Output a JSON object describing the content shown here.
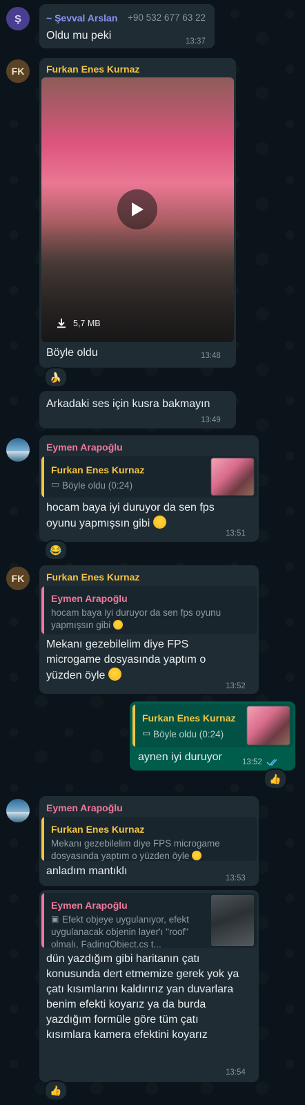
{
  "messages": [
    {
      "sender": "~ Şevval Arslan",
      "phone": "+90 532 677 63 22",
      "avatar_initial": "Ş",
      "text": "Oldu mu peki",
      "time": "13:37"
    },
    {
      "sender": "Furkan Enes Kurnaz",
      "avatar_initial": "FK",
      "video_size": "5,7 MB",
      "caption": "Böyle oldu",
      "time": "13:48",
      "reaction": "🍌"
    },
    {
      "text": "Arkadaki ses için kusra bakmayın",
      "time": "13:49"
    },
    {
      "sender": "Eymen Arapoğlu",
      "quote_name": "Furkan Enes Kurnaz",
      "quote_text": "Böyle oldu (0:24)",
      "text": "hocam baya iyi duruyor da sen fps oyunu yapmışsın gibi",
      "time": "13:51",
      "reaction": "😂"
    },
    {
      "sender": "Furkan Enes Kurnaz",
      "avatar_initial": "FK",
      "quote_name": "Eymen Arapoğlu",
      "quote_text": "hocam baya iyi duruyor da sen fps oyunu yapmışsın gibi",
      "text": "Mekanı gezebilelim diye FPS microgame dosyasında yaptım o yüzden öyle",
      "time": "13:52"
    },
    {
      "quote_name": "Furkan Enes Kurnaz",
      "quote_text": "Böyle oldu (0:24)",
      "text": "aynen iyi duruyor",
      "time": "13:52",
      "reaction": "👍"
    },
    {
      "sender": "Eymen Arapoğlu",
      "quote_name": "Furkan Enes Kurnaz",
      "quote_text": "Mekanı gezebilelim diye FPS microgame dosyasında yaptım o yüzden öyle",
      "text": "anladım mantıklı",
      "time": "13:53"
    },
    {
      "quote_name": "Eymen Arapoğlu",
      "quote_text": "Efekt objeye uygulanıyor, efekt uygulanacak objenin layer'ı \"roof\" olmalı, FadingObject.cs t...",
      "text": "dün yazdığım gibi haritanın çatı konusunda dert etmemize gerek yok ya çatı kısımlarını kaldırırız yan duvarlara benim efekti koyarız ya da burda yazdığım formüle göre tüm çatı kısımlara kamera efektini koyarız",
      "time": "13:54",
      "reaction": "👍"
    }
  ],
  "colors": {
    "sevval": "#8b94f7",
    "furkan": "#f5c542",
    "eymen": "#f0789c",
    "outgoing": "#005c4b",
    "incoming": "#1f2c33",
    "read_ticks": "#53bdeb"
  }
}
